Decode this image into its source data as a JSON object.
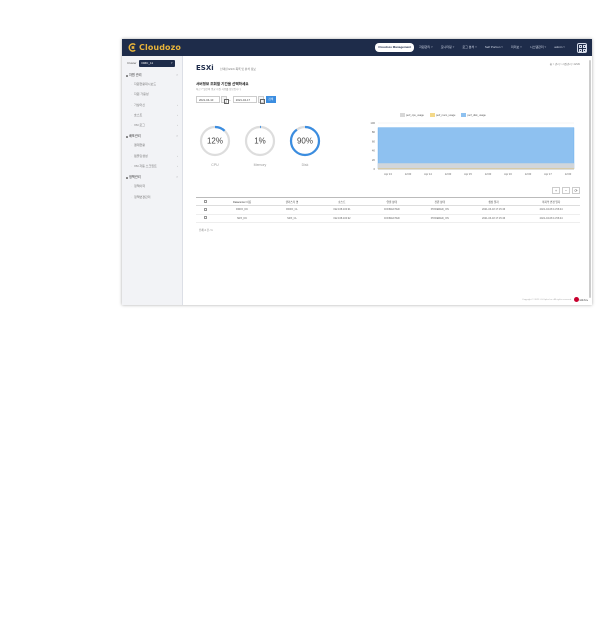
{
  "header": {
    "logo_text": "Cloudozo",
    "menu": [
      {
        "label": "Cloudozo Management",
        "active": true
      },
      {
        "label": "자원관리 ˅"
      },
      {
        "label": "모니터링 ˅"
      },
      {
        "label": "로그 분석 ˅"
      },
      {
        "label": "Self Portion ˅"
      },
      {
        "label": "미리보 ˅"
      },
      {
        "label": "시스템관리 ˅"
      },
      {
        "label": "admin ˅"
      }
    ]
  },
  "sidebar": {
    "cluster_label": "Cluster",
    "cluster_value": "DMC_11",
    "groups": [
      {
        "label": "자원 관리",
        "items": [
          {
            "label": "자원현황대시보드",
            "chev": ""
          },
          {
            "label": "자원 가용성",
            "chev": ""
          },
          {
            "label": "가상머신",
            "chev": "›"
          },
          {
            "label": "호스트",
            "chev": "›"
          },
          {
            "label": "VM 로그",
            "chev": "›"
          }
        ]
      },
      {
        "label": "배포관리",
        "items": [
          {
            "label": "결재현황",
            "chev": ""
          },
          {
            "label": "템플릿생성",
            "chev": "›"
          },
          {
            "label": "VM 자동 스크립트",
            "chev": "›"
          }
        ]
      },
      {
        "label": "정책관리",
        "items": [
          {
            "label": "정책이력",
            "chev": ""
          },
          {
            "label": "정책변경관리",
            "chev": ""
          }
        ]
      }
    ]
  },
  "page": {
    "title": "ESXi",
    "title_sub": "선택된 ESXi 목록 및 분석 정보",
    "breadcrumb": "홈 > 관리 > 자원관리 > ESXi",
    "section_title": "서버정보 조회할 기간을 선택하세요",
    "section_desc": "최근 7 일간의 평균 자원 사용률 정보입니다",
    "date_from": "2021-04-10",
    "date_sep": "~",
    "date_to": "2021-04-17",
    "search_label": "검색"
  },
  "gauges": [
    {
      "label": "CPU",
      "value": 12,
      "text": "12%"
    },
    {
      "label": "Memory",
      "value": 1,
      "text": "1%"
    },
    {
      "label": "Disk",
      "value": 90,
      "text": "90%"
    }
  ],
  "colors": {
    "cpu": "#d8d8d8",
    "mem": "#f4d98a",
    "disk": "#8ec1f0",
    "gauge_track": "#dddddd",
    "gauge_fill": "#3b8de0"
  },
  "chart_data": {
    "type": "area",
    "legend_position": "top",
    "ylim": [
      0,
      100
    ],
    "yticks": [
      0,
      20,
      40,
      60,
      80,
      100
    ],
    "categories": [
      "Apr 13",
      "12:00",
      "Apr 14",
      "12:00",
      "Apr 15",
      "12:00",
      "Apr 16",
      "12:00",
      "Apr 17",
      "12:00"
    ],
    "series": [
      {
        "name": "perf_cpu_usage",
        "color": "#d8d8d8",
        "values": [
          12,
          12,
          12,
          12,
          12,
          12,
          12,
          12,
          12,
          12,
          12
        ]
      },
      {
        "name": "perf_mem_usage",
        "color": "#f4d98a",
        "values": [
          1,
          1,
          1,
          1,
          1,
          1,
          1,
          1,
          1,
          1,
          1
        ]
      },
      {
        "name": "perf_disk_usage",
        "color": "#8ec1f0",
        "values": [
          90,
          90,
          90,
          90,
          90,
          90,
          90,
          90,
          90,
          90,
          90
        ]
      }
    ]
  },
  "toolbar": {
    "add": "+",
    "remove": "−",
    "refresh": "⟳"
  },
  "table": {
    "headers": [
      "",
      "Datacenter 이름",
      "클러스터 명",
      "호스트",
      "연결 상태",
      "전원 상태",
      "생성 일자",
      "마지막 변경 일자"
    ],
    "rows": [
      [
        "",
        "RDFO_DC",
        "RDFO_CL",
        "192.168.100.91",
        "CONNECTED",
        "POWERED_ON",
        "2021-03-18 17:15:46",
        "2021-04-08 11:56:44"
      ],
      [
        "",
        "SRX_DC",
        "SRX_CL",
        "192.168.100.92",
        "CONNECTED",
        "POWERED_ON",
        "2021-03-18 17:15:46",
        "2021-04-08 11:56:44"
      ]
    ]
  },
  "total_text": "전체 2 건 / 1",
  "footer": {
    "copyright": "Copyright © 2021 LG Uplus Inc. All rights reserved.",
    "brand": "LG U+"
  }
}
